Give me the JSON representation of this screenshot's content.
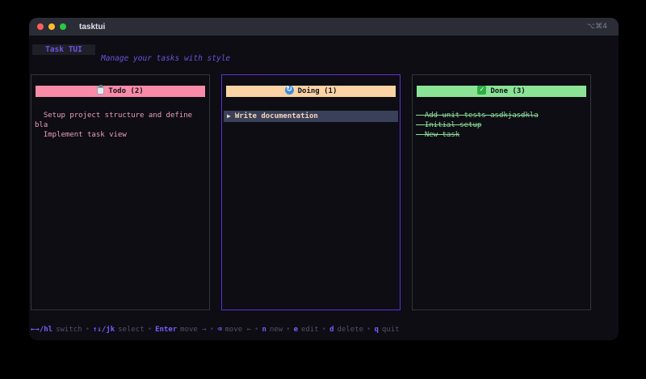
{
  "window": {
    "title": "tasktui",
    "shortcut": "⌥⌘4"
  },
  "header": {
    "app_title": "Task TUI",
    "subtitle": "Manage your tasks with style"
  },
  "columns": [
    {
      "title": "Todo (2)",
      "icon": "clipboard-icon",
      "items": [
        {
          "text": "Setup project structure and define bla"
        },
        {
          "text": "Implement task view"
        }
      ]
    },
    {
      "title": "Doing (1)",
      "icon": "refresh-icon",
      "active": true,
      "items": [
        {
          "text": "Write documentation",
          "selected": true
        }
      ]
    },
    {
      "title": "Done (3)",
      "icon": "check-icon",
      "items": [
        {
          "text": "Add unit tests asdkjasdkla",
          "done": true
        },
        {
          "text": "Initial setup",
          "done": true
        },
        {
          "text": "New task",
          "done": true
        }
      ]
    }
  ],
  "icons": {
    "selected_arrow": "▶"
  },
  "help": {
    "separator": "•",
    "entries": [
      {
        "key": "←→/hl",
        "desc": "switch"
      },
      {
        "key": "↑↓/jk",
        "desc": "select"
      },
      {
        "key": "Enter",
        "desc": "move →"
      },
      {
        "key": "⌫",
        "desc": "move ←"
      },
      {
        "key": "n",
        "desc": "new"
      },
      {
        "key": "e",
        "desc": "edit"
      },
      {
        "key": "d",
        "desc": "delete"
      },
      {
        "key": "q",
        "desc": "quit"
      }
    ]
  },
  "colors": {
    "accent_purple": "#6f52e0",
    "active_border": "#5f2fd8",
    "todo_header": "#f98ba9",
    "doing_header": "#fbd3a4",
    "done_header": "#8be495",
    "todo_text": "#ec9fbe",
    "done_text": "#8fe09c",
    "selected_row_bg": "#3a4059",
    "selected_row_text": "#f4d7b8",
    "titlebar_bg": "#2a2d36",
    "terminal_bg": "#0d0d13"
  }
}
